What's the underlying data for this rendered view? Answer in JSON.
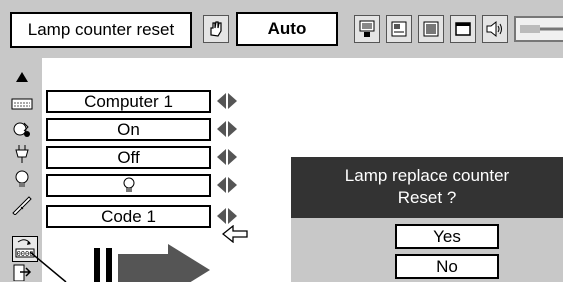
{
  "topbar": {
    "title": "Lamp counter reset",
    "mode_value": "Auto",
    "icons": [
      "hand-icon",
      "pc-adjust-icon",
      "image-select-icon",
      "image-adjust-icon",
      "screen-icon",
      "sound-icon",
      "setting-tab-icon"
    ]
  },
  "side_icons": [
    "up-arrow-icon",
    "keyboard-icon",
    "power-management-icon",
    "plug-icon",
    "lamp-icon",
    "key-icon",
    "lamp-counter-reset-icon",
    "exit-icon"
  ],
  "rows": [
    {
      "name": "input-row",
      "value": "Computer 1"
    },
    {
      "name": "power-row",
      "value": "On"
    },
    {
      "name": "auto-power-row",
      "value": "Off"
    },
    {
      "name": "lamp-row",
      "value": ""
    },
    {
      "name": "security-row",
      "value": "Code 1"
    }
  ],
  "dialog": {
    "line1": "Lamp replace counter",
    "line2": "Reset ?",
    "yes": "Yes",
    "no": "No"
  },
  "colors": {
    "panel_gray": "#c8c8c8",
    "dialog_header": "#333333",
    "arrow_dark": "#555555"
  }
}
